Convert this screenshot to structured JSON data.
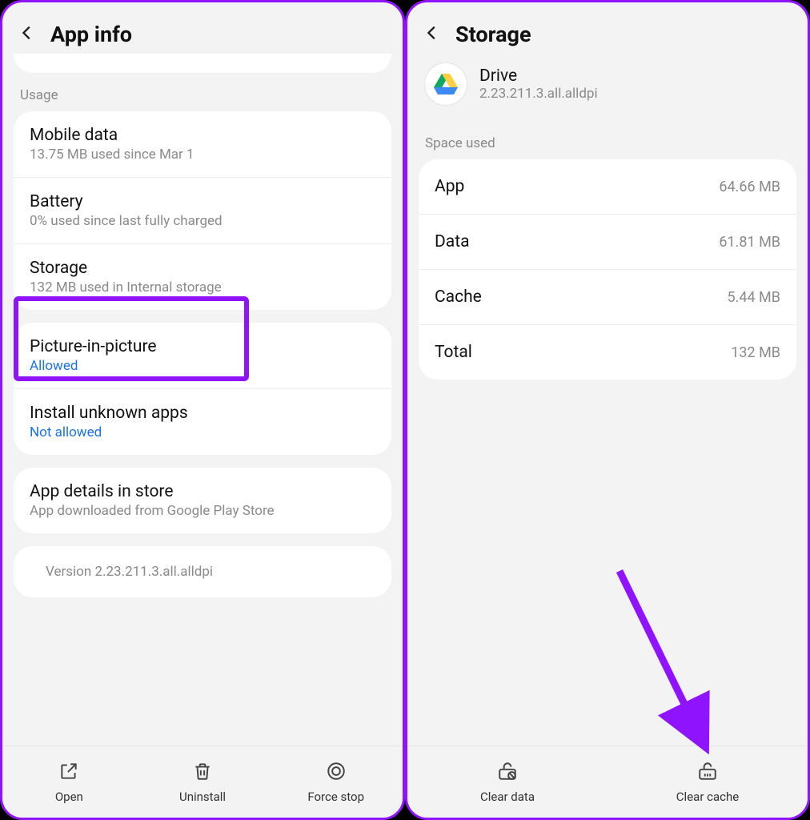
{
  "left": {
    "title": "App info",
    "section_usage": "Usage",
    "mobile_data": {
      "title": "Mobile data",
      "sub": "13.75 MB used since Mar 1"
    },
    "battery": {
      "title": "Battery",
      "sub": "0% used since last fully charged"
    },
    "storage": {
      "title": "Storage",
      "sub": "132 MB used in Internal storage"
    },
    "pip": {
      "title": "Picture-in-picture",
      "sub": "Allowed"
    },
    "unknown": {
      "title": "Install unknown apps",
      "sub": "Not allowed"
    },
    "details": {
      "title": "App details in store",
      "sub": "App downloaded from Google Play Store"
    },
    "version": "Version 2.23.211.3.all.alldpi",
    "bottom": {
      "open": "Open",
      "uninstall": "Uninstall",
      "force_stop": "Force stop"
    }
  },
  "right": {
    "title": "Storage",
    "app": {
      "name": "Drive",
      "version": "2.23.211.3.all.alldpi"
    },
    "section_space": "Space used",
    "rows": {
      "app": {
        "label": "App",
        "val": "64.66 MB"
      },
      "data": {
        "label": "Data",
        "val": "61.81 MB"
      },
      "cache": {
        "label": "Cache",
        "val": "5.44 MB"
      },
      "total": {
        "label": "Total",
        "val": "132 MB"
      }
    },
    "bottom": {
      "clear_data": "Clear data",
      "clear_cache": "Clear cache"
    }
  }
}
